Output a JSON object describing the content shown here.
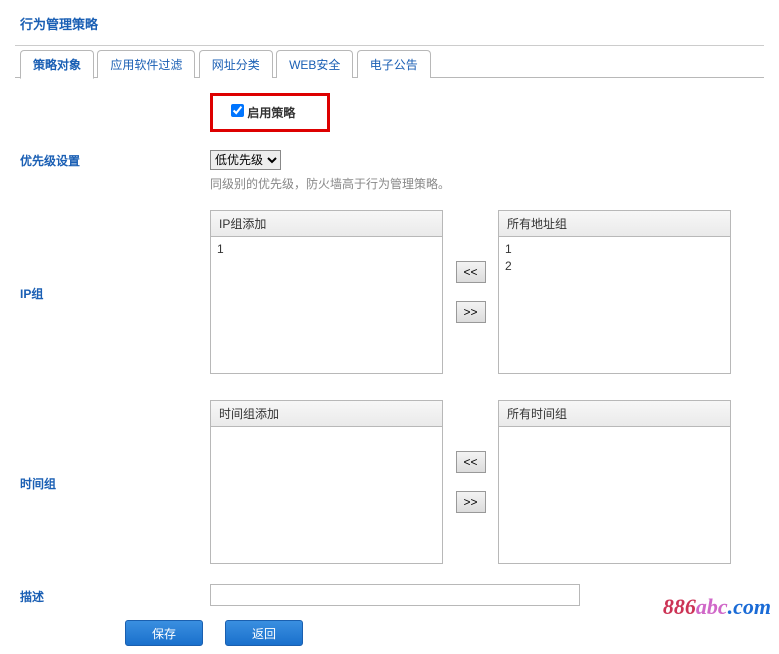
{
  "title": "行为管理策略",
  "tabs": {
    "t0": "策略对象",
    "t1": "应用软件过滤",
    "t2": "网址分类",
    "t3": "WEB安全",
    "t4": "电子公告"
  },
  "enable": {
    "label": "启用策略",
    "checked": true
  },
  "priority": {
    "label": "优先级设置",
    "selected": "低优先级",
    "hint": "同级别的优先级，防火墙高于行为管理策略。"
  },
  "ipgroup": {
    "label": "IP组",
    "left_title": "IP组添加",
    "left_items": [
      "1"
    ],
    "right_title": "所有地址组",
    "right_items": [
      "1",
      "2"
    ]
  },
  "timegroup": {
    "label": "时间组",
    "left_title": "时间组添加",
    "left_items": [],
    "right_title": "所有时间组",
    "right_items": []
  },
  "arrows": {
    "left": "<<",
    "right": ">>"
  },
  "desc": {
    "label": "描述",
    "value": ""
  },
  "buttons": {
    "save": "保存",
    "back": "返回"
  },
  "watermark": {
    "a": "886",
    "b": "abc",
    "c": ".c",
    "d": "om"
  }
}
